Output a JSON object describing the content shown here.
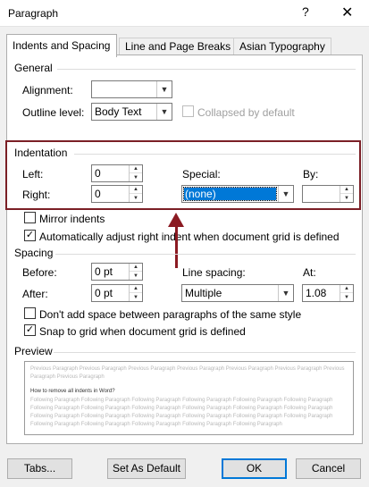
{
  "window": {
    "title": "Paragraph",
    "help": "?",
    "close": "✕"
  },
  "tabs": [
    {
      "label": "Indents and Spacing"
    },
    {
      "label": "Line and Page Breaks"
    },
    {
      "label": "Asian Typography"
    }
  ],
  "general": {
    "heading": "General",
    "alignment_label": "Alignment:",
    "alignment_value": "",
    "outline_label": "Outline level:",
    "outline_value": "Body Text",
    "collapsed_label": "Collapsed by default"
  },
  "indentation": {
    "heading": "Indentation",
    "left_label": "Left:",
    "left_value": "0",
    "right_label": "Right:",
    "right_value": "0",
    "special_label": "Special:",
    "special_value": "(none)",
    "by_label": "By:",
    "by_value": "",
    "mirror_label": "Mirror indents",
    "auto_adjust_label": "Automatically adjust right indent when document grid is defined"
  },
  "spacing": {
    "heading": "Spacing",
    "before_label": "Before:",
    "before_value": "0 pt",
    "after_label": "After:",
    "after_value": "0 pt",
    "line_spacing_label": "Line spacing:",
    "line_spacing_value": "Multiple",
    "at_label": "At:",
    "at_value": "1.08",
    "dont_add_label": "Don't add space between paragraphs of the same style",
    "snap_label": "Snap to grid when document grid is defined"
  },
  "preview": {
    "heading": "Preview",
    "previous": "Previous Paragraph Previous Paragraph Previous Paragraph Previous Paragraph Previous Paragraph Previous Paragraph Previous Paragraph Previous Paragraph",
    "current": "How to remove all indents in Word?",
    "following": "Following Paragraph Following Paragraph Following Paragraph Following Paragraph Following Paragraph Following Paragraph Following Paragraph Following Paragraph Following Paragraph Following Paragraph Following Paragraph Following Paragraph Following Paragraph Following Paragraph Following Paragraph Following Paragraph Following Paragraph Following Paragraph Following Paragraph Following Paragraph Following Paragraph Following Paragraph Following Paragraph"
  },
  "buttons": {
    "tabs": "Tabs...",
    "set_default": "Set As Default",
    "ok": "OK",
    "cancel": "Cancel"
  },
  "colors": {
    "highlight": "#7b1f26",
    "selection": "#0078d7"
  },
  "checkboxes": {
    "mirror_checked": false,
    "auto_adjust_checked": true,
    "dont_add_checked": false,
    "snap_checked": true,
    "collapsed_checked": false
  }
}
